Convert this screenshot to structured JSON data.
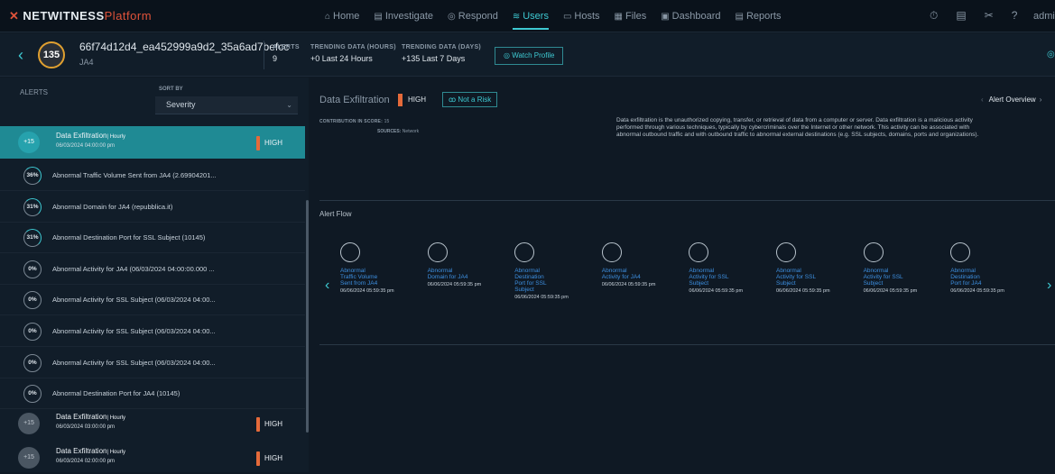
{
  "app": {
    "brand": "NETWITNESS",
    "brand_suffix": "Platform",
    "user": "admin"
  },
  "nav": [
    {
      "label": "Home",
      "icon": "home-icon",
      "glyph": "⌂",
      "active": false
    },
    {
      "label": "Investigate",
      "icon": "investigate-icon",
      "glyph": "▤",
      "active": false
    },
    {
      "label": "Respond",
      "icon": "respond-icon",
      "glyph": "◎",
      "active": false
    },
    {
      "label": "Users",
      "icon": "users-icon",
      "glyph": "≋",
      "active": true
    },
    {
      "label": "Hosts",
      "icon": "hosts-icon",
      "glyph": "▭",
      "active": false
    },
    {
      "label": "Files",
      "icon": "files-icon",
      "glyph": "▦",
      "active": false
    },
    {
      "label": "Dashboard",
      "icon": "dashboard-icon",
      "glyph": "▣",
      "active": false
    },
    {
      "label": "Reports",
      "icon": "reports-icon",
      "glyph": "▤",
      "active": false
    }
  ],
  "profile": {
    "score": "135",
    "name": "66f74d12d4_ea452999a9d2_35a6ad7befcc",
    "subtitle": "JA4",
    "alerts_label": "ALERTS",
    "alerts_value": "9",
    "trend_hours_label": "TRENDING DATA (HOURS)",
    "trend_hours_value": "+0  Last 24 Hours",
    "trend_days_label": "TRENDING DATA (DAYS)",
    "trend_days_value": "+135  Last 7 Days",
    "watch_label": "Watch Profile"
  },
  "left": {
    "alerts_header": "ALERTS",
    "sort_by_label": "SORT BY",
    "sort_value": "Severity",
    "alerts": [
      {
        "score": "+15",
        "title": "Data Exfiltration",
        "freq": "| Hourly",
        "date": "06/03/2024 04:00:00 pm",
        "severity": "HIGH"
      },
      {
        "score": "+15",
        "title": "Data Exfiltration",
        "freq": "| Hourly",
        "date": "06/03/2024 03:00:00 pm",
        "severity": "HIGH"
      },
      {
        "score": "+15",
        "title": "Data Exfiltration",
        "freq": "| Hourly",
        "date": "06/03/2024 02:00:00 pm",
        "severity": "HIGH"
      }
    ],
    "indicators": [
      {
        "pct": "36%",
        "label": "Abnormal Traffic Volume Sent from JA4 (2.69904201..."
      },
      {
        "pct": "31%",
        "label": "Abnormal Domain for JA4 (repubblica.it)"
      },
      {
        "pct": "31%",
        "label": "Abnormal Destination Port for SSL Subject (10145)"
      },
      {
        "pct": "0%",
        "label": "Abnormal Activity for JA4 (06/03/2024 04:00:00.000 ..."
      },
      {
        "pct": "0%",
        "label": "Abnormal Activity for SSL Subject (06/03/2024 04:00..."
      },
      {
        "pct": "0%",
        "label": "Abnormal Activity for SSL Subject (06/03/2024 04:00..."
      },
      {
        "pct": "0%",
        "label": "Abnormal Activity for SSL Subject (06/03/2024 04:00..."
      },
      {
        "pct": "0%",
        "label": "Abnormal Destination Port for JA4 (10145)"
      }
    ]
  },
  "main": {
    "title": "Data Exfiltration",
    "severity": "HIGH",
    "not_risk_label": "Not a Risk",
    "alert_overview_label": "Alert Overview",
    "contribution_label": "CONTRIBUTION IN SCORE:",
    "contribution_value": "15",
    "sources_label": "SOURCES:",
    "sources_value": "Network",
    "description_lines": [
      "Data exfiltration is the unauthorized copying, transfer, or retrieval of data from a computer or server. Data exfiltration is a malicious activity",
      "performed through various techniques, typically by cybercriminals over the Internet or other network. This activity can be associated with",
      "abnormal outbound traffic and with outbound traffic to abnormal external destinations (e.g. SSL subjects, domains, ports and organizations)."
    ],
    "flow_title": "Alert Flow",
    "flow": [
      {
        "lines": [
          "Abnormal",
          "Traffic Volume",
          "Sent from JA4"
        ],
        "date": "06/06/2024 05:59:35 pm"
      },
      {
        "lines": [
          "Abnormal",
          "Domain for JA4"
        ],
        "date": "06/06/2024 05:59:35 pm"
      },
      {
        "lines": [
          "Abnormal",
          "Destination",
          "Port for SSL",
          "Subject"
        ],
        "date": "06/06/2024 05:59:35 pm"
      },
      {
        "lines": [
          "Abnormal",
          "Activity for JA4"
        ],
        "date": "06/06/2024 05:59:35 pm"
      },
      {
        "lines": [
          "Abnormal",
          "Activity for SSL",
          "Subject"
        ],
        "date": "06/06/2024 05:59:35 pm"
      },
      {
        "lines": [
          "Abnormal",
          "Activity for SSL",
          "Subject"
        ],
        "date": "06/06/2024 05:59:35 pm"
      },
      {
        "lines": [
          "Abnormal",
          "Activity for SSL",
          "Subject"
        ],
        "date": "06/06/2024 05:59:35 pm"
      },
      {
        "lines": [
          "Abnormal",
          "Destination",
          "Port for JA4"
        ],
        "date": "06/06/2024 05:59:35 pm"
      }
    ]
  }
}
